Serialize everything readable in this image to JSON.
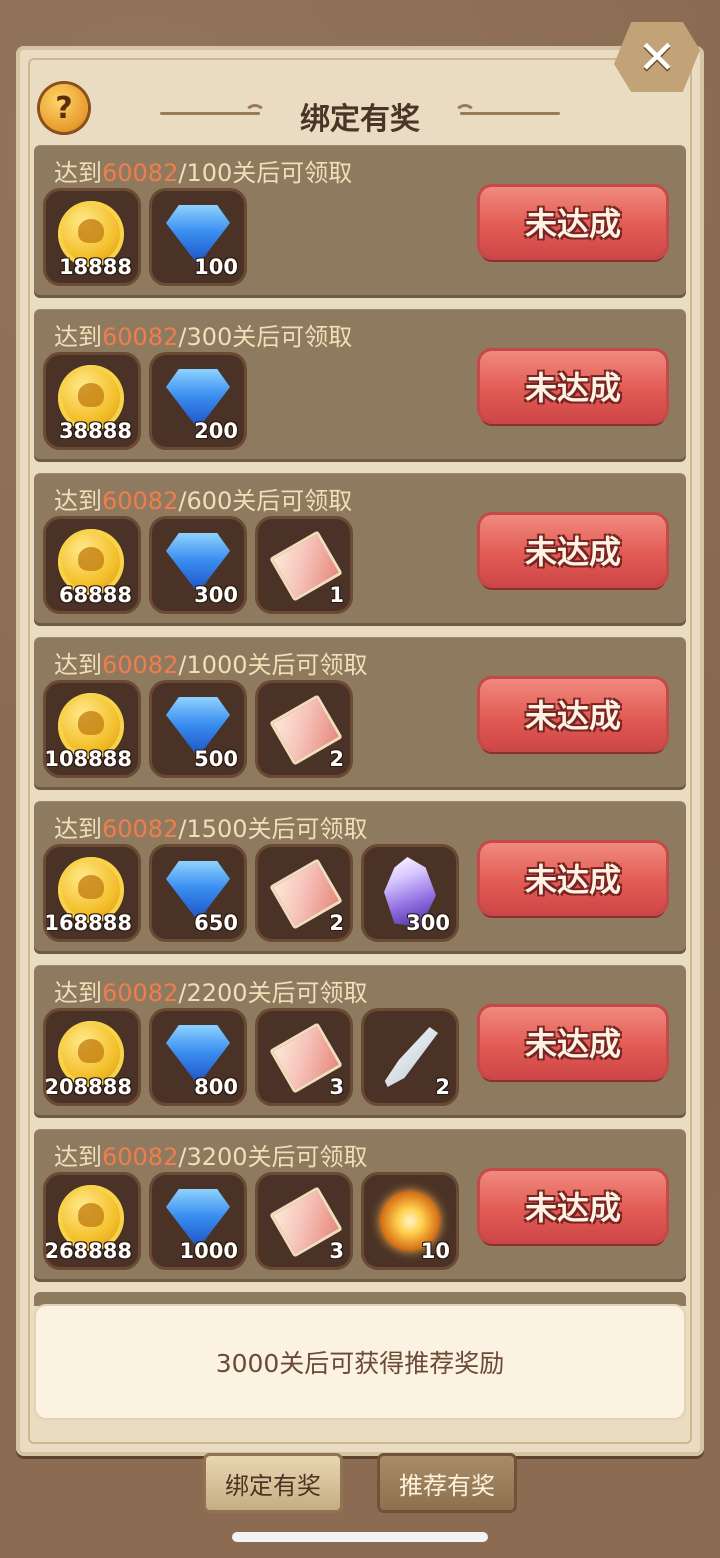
{
  "header": {
    "title": "绑定有奖",
    "help_icon_glyph": "?",
    "close_icon_glyph": "✕"
  },
  "rows": [
    {
      "prefix": "达到",
      "current": "60082",
      "target_suffix": "/100关后可领取",
      "button": "未达成",
      "rewards": [
        {
          "icon": "gold-coin",
          "qty": "18888"
        },
        {
          "icon": "blue-diamond",
          "qty": "100"
        }
      ]
    },
    {
      "prefix": "达到",
      "current": "60082",
      "target_suffix": "/300关后可领取",
      "button": "未达成",
      "rewards": [
        {
          "icon": "gold-coin",
          "qty": "38888"
        },
        {
          "icon": "blue-diamond",
          "qty": "200"
        }
      ]
    },
    {
      "prefix": "达到",
      "current": "60082",
      "target_suffix": "/600关后可领取",
      "button": "未达成",
      "rewards": [
        {
          "icon": "gold-coin",
          "qty": "68888"
        },
        {
          "icon": "blue-diamond",
          "qty": "300"
        },
        {
          "icon": "ticket",
          "qty": "1"
        }
      ]
    },
    {
      "prefix": "达到",
      "current": "60082",
      "target_suffix": "/1000关后可领取",
      "button": "未达成",
      "rewards": [
        {
          "icon": "gold-coin",
          "qty": "108888"
        },
        {
          "icon": "blue-diamond",
          "qty": "500"
        },
        {
          "icon": "ticket",
          "qty": "2"
        }
      ]
    },
    {
      "prefix": "达到",
      "current": "60082",
      "target_suffix": "/1500关后可领取",
      "button": "未达成",
      "rewards": [
        {
          "icon": "gold-coin",
          "qty": "168888"
        },
        {
          "icon": "blue-diamond",
          "qty": "650"
        },
        {
          "icon": "ticket",
          "qty": "2"
        },
        {
          "icon": "crystal",
          "qty": "300"
        }
      ]
    },
    {
      "prefix": "达到",
      "current": "60082",
      "target_suffix": "/2200关后可领取",
      "button": "未达成",
      "rewards": [
        {
          "icon": "gold-coin",
          "qty": "208888"
        },
        {
          "icon": "blue-diamond",
          "qty": "800"
        },
        {
          "icon": "ticket",
          "qty": "3"
        },
        {
          "icon": "feather",
          "qty": "2"
        }
      ]
    },
    {
      "prefix": "达到",
      "current": "60082",
      "target_suffix": "/3200关后可领取",
      "button": "未达成",
      "rewards": [
        {
          "icon": "gold-coin",
          "qty": "268888"
        },
        {
          "icon": "blue-diamond",
          "qty": "1000"
        },
        {
          "icon": "ticket",
          "qty": "3"
        },
        {
          "icon": "orb",
          "qty": "10"
        }
      ]
    }
  ],
  "notice": "3000关后可获得推荐奖励",
  "tabs": [
    {
      "label": "绑定有奖",
      "active": true
    },
    {
      "label": "推荐有奖",
      "active": false
    }
  ],
  "colors": {
    "highlight": "#f07d4d",
    "button_red": "#e25c55",
    "row_bg": "#8e7a5f"
  }
}
